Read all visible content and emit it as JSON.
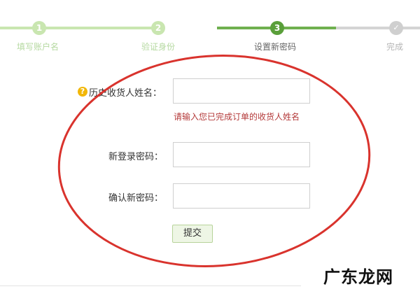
{
  "steps": [
    {
      "number": "1",
      "label": "填写账户名",
      "state": "done"
    },
    {
      "number": "2",
      "label": "验证身份",
      "state": "done"
    },
    {
      "number": "3",
      "label": "设置新密码",
      "state": "current"
    },
    {
      "number": "✓",
      "label": "完成",
      "state": "todo"
    }
  ],
  "form": {
    "hint_icon": "?",
    "name_label": "历史收货人姓名：",
    "name_value": "",
    "name_error": "请输入您已完成订单的收货人姓名",
    "new_password_label": "新登录密码：",
    "new_password_value": "",
    "confirm_password_label": "确认新密码：",
    "confirm_password_value": "",
    "submit_label": "提交"
  },
  "watermark": "广东龙网",
  "colors": {
    "step_done": "#c9e6b0",
    "step_current": "#5a9f3a",
    "step_todo": "#cfcfcf",
    "error_text": "#b43a3a",
    "annotation_oval": "#d9332d",
    "hint_icon": "#f2b707"
  },
  "icons": {
    "hint": "question-icon",
    "done_step": "check-icon"
  }
}
